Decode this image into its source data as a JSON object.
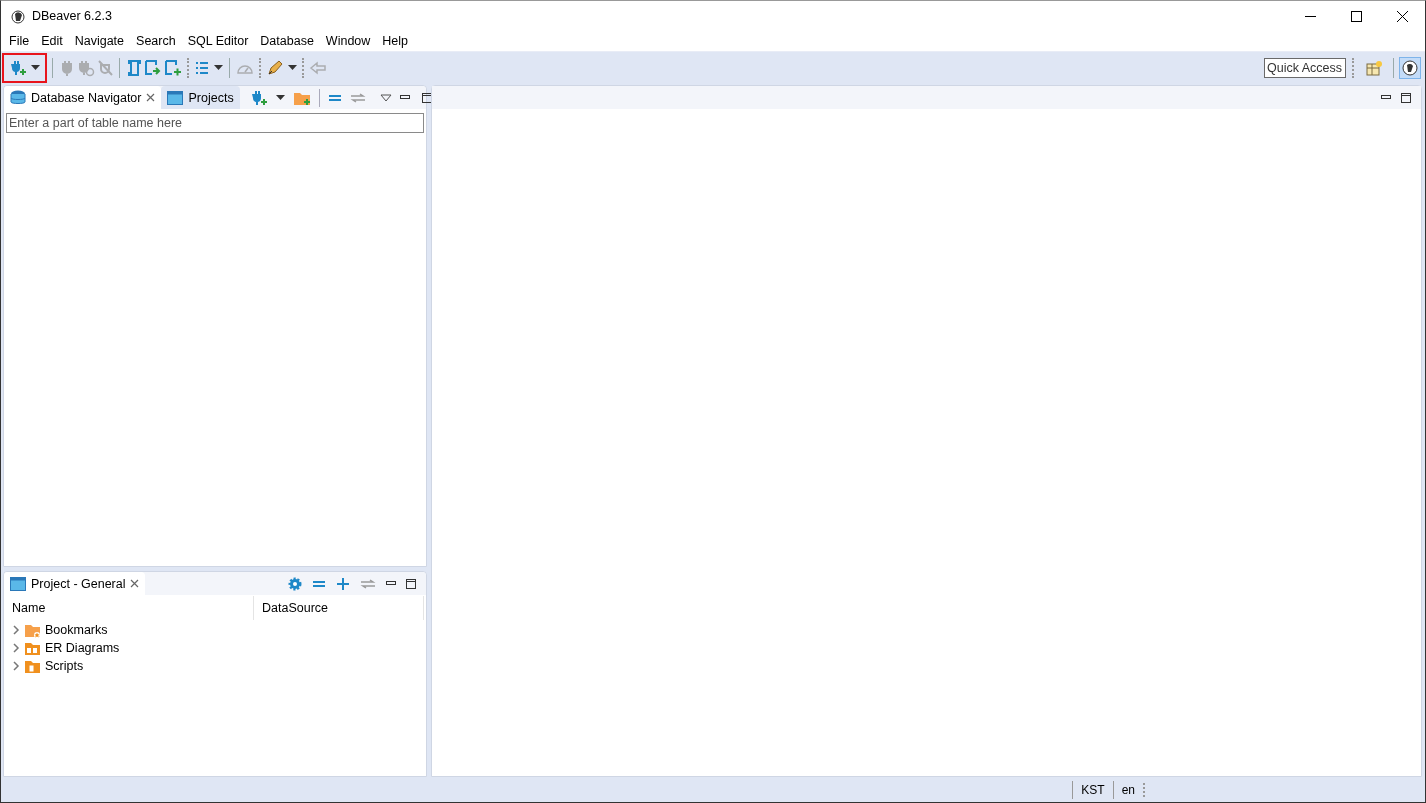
{
  "window": {
    "title": "DBeaver 6.2.3"
  },
  "menu": [
    "File",
    "Edit",
    "Navigate",
    "Search",
    "SQL Editor",
    "Database",
    "Window",
    "Help"
  ],
  "toolbar": {
    "buttons": [
      {
        "disabled": false,
        "highlighted": true
      },
      {
        "disabled": true,
        "highlighted": false
      },
      {
        "disabled": true,
        "highlighted": false
      },
      {
        "disabled": true,
        "highlighted": false
      },
      {
        "disabled": false,
        "highlighted": false
      },
      {
        "disabled": false,
        "highlighted": false
      },
      {
        "disabled": false,
        "highlighted": false
      },
      {
        "disabled": false,
        "highlighted": false
      },
      {
        "disabled": true,
        "highlighted": false
      },
      {
        "disabled": false,
        "highlighted": false
      },
      {
        "disabled": true,
        "highlighted": false
      }
    ],
    "quick_access": {
      "placeholder": "Quick Access"
    }
  },
  "navigator": {
    "tabs": [
      {
        "label": "Database Navigator",
        "selected": true
      },
      {
        "label": "Projects",
        "selected": false
      }
    ],
    "filter": {
      "placeholder": "Enter a part of table name here"
    }
  },
  "project": {
    "tab": {
      "label": "Project - General",
      "selected": true
    },
    "columns": [
      "Name",
      "DataSource"
    ],
    "items": [
      {
        "name": "Bookmarks",
        "expanded": false
      },
      {
        "name": "ER Diagrams",
        "expanded": false
      },
      {
        "name": "Scripts",
        "expanded": false
      }
    ]
  },
  "status_bar": [
    "KST",
    "en"
  ]
}
